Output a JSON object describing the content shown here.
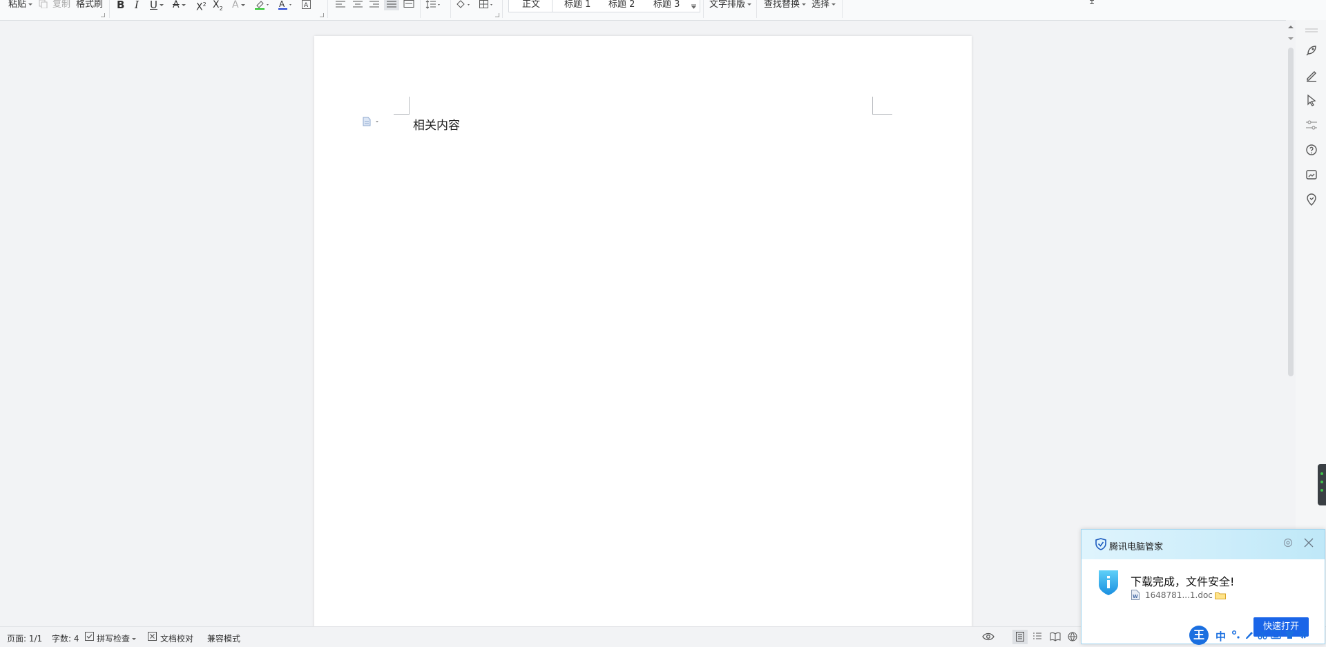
{
  "toolbar": {
    "paste": "粘贴",
    "copy": "复制",
    "format_painter": "格式刷",
    "styles": {
      "normal": "正文",
      "heading1": "标题 1",
      "heading2": "标题 2",
      "heading3": "标题 3"
    },
    "text_layout": "文字排版",
    "find_replace": "查找替换",
    "select": "选择",
    "icons": [
      "bold-icon",
      "italic-icon",
      "underline-icon",
      "strikethrough-icon",
      "superscript-icon",
      "subscript-icon",
      "text-effect-icon",
      "highlight-icon",
      "font-color-icon",
      "char-border-icon",
      "align-left-icon",
      "align-center-icon",
      "align-right-icon",
      "justify-icon",
      "distributed-icon",
      "line-spacing-icon",
      "shading-icon",
      "border-icon"
    ],
    "colors": {
      "highlight": "#22c322",
      "font_color": "#1f3fd1"
    }
  },
  "document": {
    "text": "相关内容"
  },
  "statusbar": {
    "page": "页面: 1/1",
    "word_count": "字数: 4",
    "spell_check": "拼写检查",
    "doc_proof": "文档校对",
    "compat_mode": "兼容模式"
  },
  "popup": {
    "title": "腾讯电脑管家",
    "message": "下载完成，文件安全!",
    "filename": "1648781...1.doc",
    "open_button": "快速打开"
  },
  "ime": {
    "logo": "王",
    "mode": "中"
  }
}
